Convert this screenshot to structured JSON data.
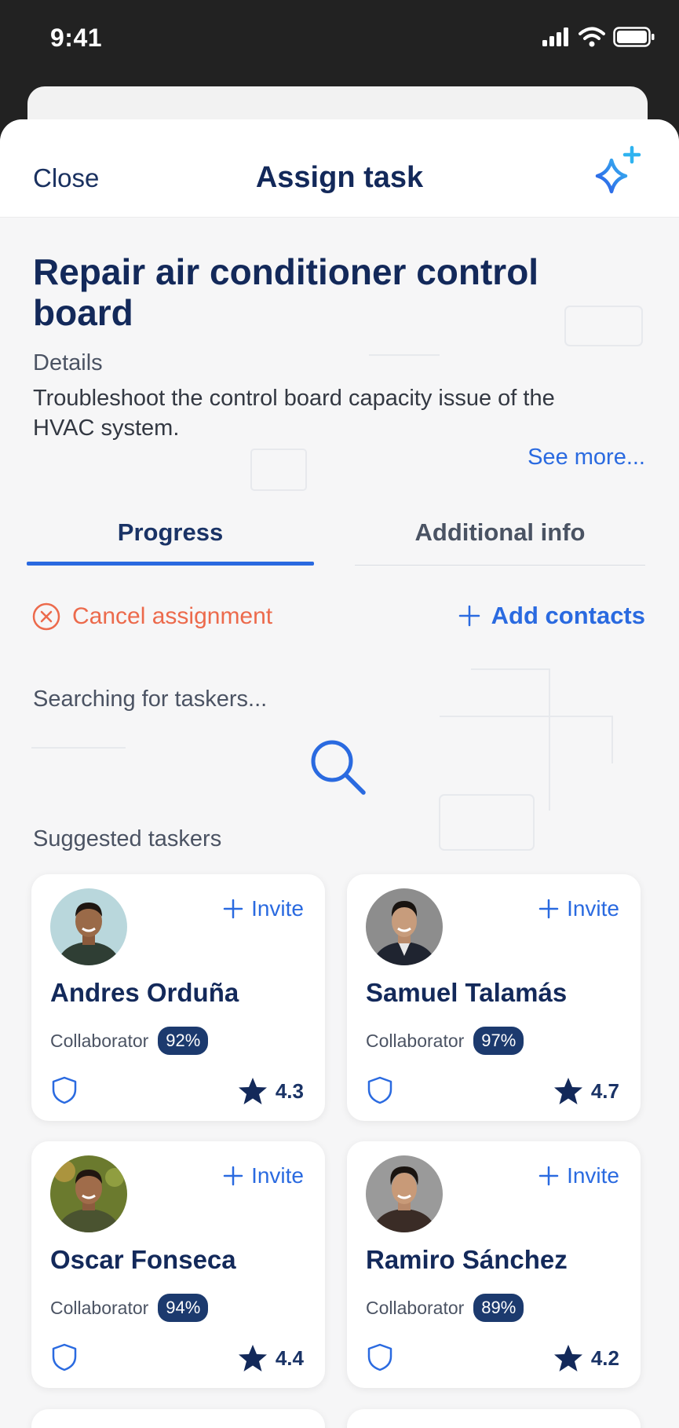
{
  "status_bar": {
    "time": "9:41"
  },
  "nav": {
    "close_label": "Close",
    "title": "Assign task",
    "ai_icon": "sparkle-icon"
  },
  "task": {
    "title": "Repair air conditioner control board",
    "details_label": "Details",
    "details_text": "Troubleshoot the control board capacity issue of the HVAC system.",
    "see_more": "See more..."
  },
  "tabs": [
    {
      "label": "Progress",
      "active": true
    },
    {
      "label": "Additional info",
      "active": false
    }
  ],
  "actions": {
    "cancel_label": "Cancel assignment",
    "add_contacts_label": "Add contacts"
  },
  "search": {
    "status": "Searching for taskers..."
  },
  "suggested": {
    "heading": "Suggested taskers",
    "invite_label": "Invite",
    "taskers": [
      {
        "name": "Andres Orduña",
        "role": "Collaborator",
        "match": "92%",
        "rating": "4.3"
      },
      {
        "name": "Samuel Talamás",
        "role": "Collaborator",
        "match": "97%",
        "rating": "4.7"
      },
      {
        "name": "Oscar Fonseca",
        "role": "Collaborator",
        "match": "94%",
        "rating": "4.4"
      },
      {
        "name": "Ramiro Sánchez",
        "role": "Collaborator",
        "match": "89%",
        "rating": "4.2"
      }
    ]
  },
  "colors": {
    "navy": "#13295a",
    "accent": "#2a6ae0",
    "cancel": "#ec6a4c",
    "badge": "#1c3a6e"
  }
}
